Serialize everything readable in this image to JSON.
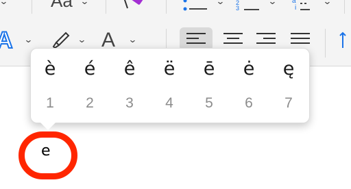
{
  "toolbar": {
    "row1": {
      "font_style_label": "Aa",
      "list_numbers_1": "1",
      "list_numbers_2": "2",
      "list_numbers_3": "3",
      "alpha_label": "a",
      "alpha_sub": "i"
    },
    "row2": {
      "text_color_label": "A",
      "font_color_label": "A"
    }
  },
  "accent_menu": {
    "options": [
      {
        "char": "è",
        "number": "1"
      },
      {
        "char": "é",
        "number": "2"
      },
      {
        "char": "ê",
        "number": "3"
      },
      {
        "char": "ë",
        "number": "4"
      },
      {
        "char": "ē",
        "number": "5"
      },
      {
        "char": "ė",
        "number": "6"
      },
      {
        "char": "ę",
        "number": "7"
      }
    ]
  },
  "typed_character": "e",
  "colors": {
    "highlight_ring": "#ff2600",
    "accent_blue": "#1a73e8",
    "eraser_purple": "#a32fd3"
  }
}
